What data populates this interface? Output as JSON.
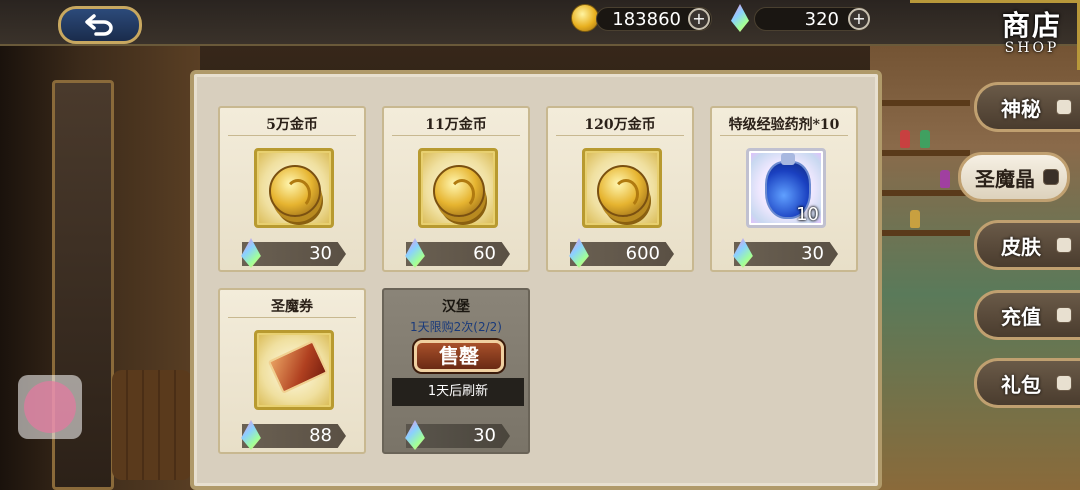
{
  "topbar": {
    "gold_amount": "183860",
    "gem_amount": "320",
    "plus_label": "+"
  },
  "shop": {
    "title_cn": "商店",
    "title_en": "SHOP"
  },
  "items": [
    {
      "name": "5万金币",
      "price": "30",
      "icon": "gold-coins-icon"
    },
    {
      "name": "11万金币",
      "price": "60",
      "icon": "gold-coins-icon"
    },
    {
      "name": "120万金币",
      "price": "600",
      "icon": "gold-coins-icon"
    },
    {
      "name": "特级经验药剂*10",
      "price": "30",
      "icon": "blue-potion-icon",
      "count": "10"
    },
    {
      "name": "圣魔券",
      "price": "88",
      "icon": "ticket-icon"
    },
    {
      "name": "汉堡",
      "price": "30",
      "icon": "burger-icon",
      "limit": "1天限购2次(2/2)",
      "soldout": "售罄",
      "refresh": "1天后刷新"
    }
  ],
  "tabs": [
    {
      "label": "神秘",
      "icon": "dice-icon"
    },
    {
      "label": "圣魔晶",
      "icon": "crystal-icon",
      "active": true
    },
    {
      "label": "皮肤",
      "icon": "shirt-icon"
    },
    {
      "label": "充值",
      "icon": "gem-icon"
    },
    {
      "label": "礼包",
      "icon": "gift-icon"
    }
  ],
  "colors": {
    "panel": "#d8cfbe",
    "card": "#f3ecda",
    "tab_active": "#f6f0e4",
    "tab_inactive": "#5a4a3a",
    "soldout_badge": "#8a3a1a",
    "back_button": "#2c4a7a"
  }
}
